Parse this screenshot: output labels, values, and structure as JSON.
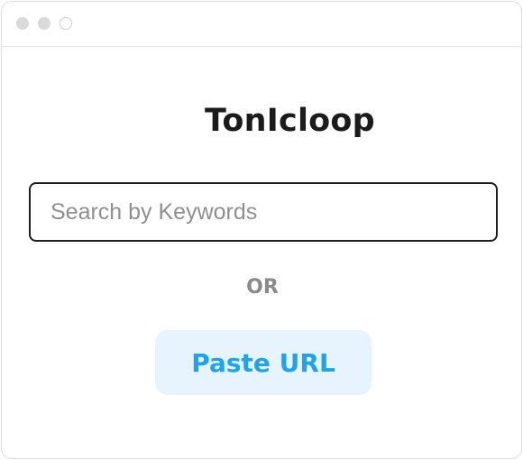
{
  "app": {
    "name": "TonIcloop",
    "logo_icon": "waveform-t-icon",
    "brand_gradient": [
      "#2ac3ff",
      "#8a5cff",
      "#e25cff"
    ]
  },
  "window": {
    "controls": [
      "close-dot",
      "minimize-dot",
      "maximize-dot"
    ]
  },
  "search": {
    "placeholder": "Search by Keywords",
    "value": ""
  },
  "divider_text": "OR",
  "paste_button": {
    "label": "Paste URL",
    "text_color": "#1ea4ee",
    "background": "#e7f4fd"
  }
}
